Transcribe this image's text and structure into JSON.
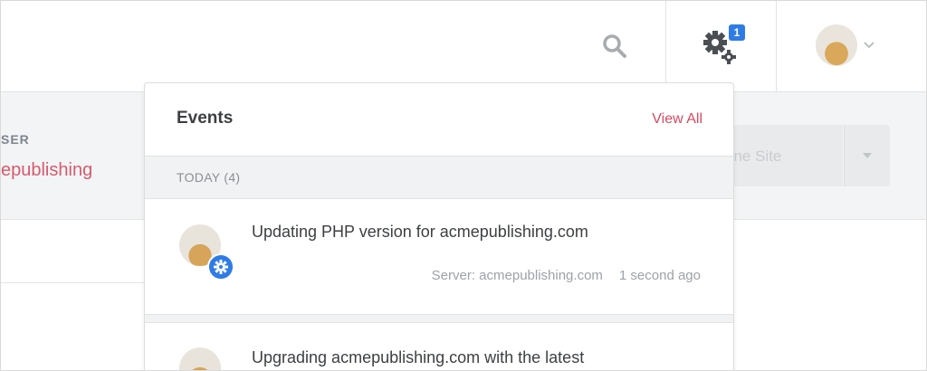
{
  "header": {
    "notifications_count": "1",
    "icons": {
      "search": "search-icon",
      "settings": "gears-icon",
      "chevron": "chevron-down-icon"
    }
  },
  "band": {
    "user_label": "SER",
    "user_name": "epublishing",
    "clone_label": "one Site"
  },
  "events": {
    "title": "Events",
    "view_all": "View All",
    "section_label": "TODAY (4)",
    "items": [
      {
        "title": "Updating PHP version for acmepublishing.com",
        "server": "Server: acmepublishing.com",
        "time": "1 second ago"
      },
      {
        "title": "Upgrading acmepublishing.com with the latest"
      }
    ]
  },
  "colors": {
    "accent": "#d94a62",
    "badge": "#2f7be6",
    "band_bg": "#f3f4f5"
  }
}
